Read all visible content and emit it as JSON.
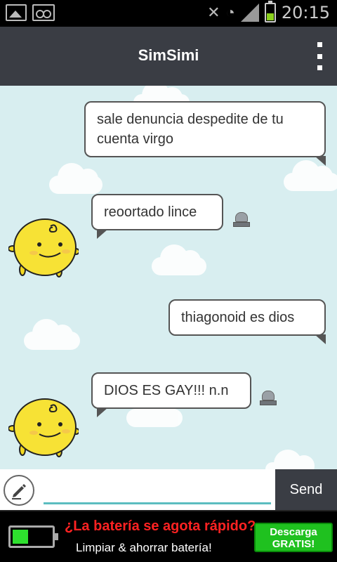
{
  "statusbar": {
    "time": "20:15",
    "icons": [
      "gallery-icon",
      "voicemail-icon",
      "mute-icon",
      "wifi-icon",
      "signal-icon",
      "battery-icon"
    ],
    "battery_color": "#8bd11d"
  },
  "header": {
    "title": "SimSimi",
    "background": "#3a3d44"
  },
  "chat": {
    "background": "#d8eef0",
    "messages": [
      {
        "sender": "user",
        "text": "sale denuncia despedite de tu cuenta virgo"
      },
      {
        "sender": "simsimi",
        "text": "reoortado lince"
      },
      {
        "sender": "user",
        "text": "thiagonoid es dios"
      },
      {
        "sender": "simsimi",
        "text": "DIOS ES GAY!!! n.n"
      }
    ]
  },
  "input": {
    "value": "",
    "send_label": "Send",
    "accent": "#5bbdc0"
  },
  "ad": {
    "headline": "¿La batería se agota rápido?",
    "subline": "Limpiar & ahorrar batería!",
    "cta_line1": "Descarga",
    "cta_line2": "GRATIS!",
    "headline_color": "#ff2222",
    "cta_color": "#1fc11f"
  }
}
